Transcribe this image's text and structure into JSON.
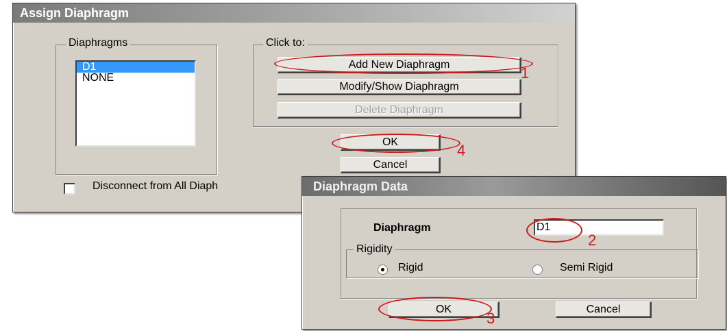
{
  "assign": {
    "title": "Assign Diaphragm",
    "diaphragms_group": "Diaphragms",
    "list": [
      "D1",
      "NONE"
    ],
    "click_group": "Click to:",
    "add_button": "Add New Diaphragm",
    "modify_button": "Modify/Show Diaphragm",
    "delete_button": "Delete Diaphragm",
    "ok_button": "OK",
    "cancel_button": "Cancel",
    "disconnect_label": "Disconnect from All Diaph"
  },
  "data_dialog": {
    "title": "Diaphragm Data",
    "diaphragm_label": "Diaphragm",
    "diaphragm_value": "D1",
    "rigidity_group": "Rigidity",
    "rigid_label": "Rigid",
    "semi_rigid_label": "Semi Rigid",
    "selected_rigidity": "Rigid",
    "ok_button": "OK",
    "cancel_button": "Cancel"
  },
  "annotations": {
    "step1": "1",
    "step2": "2",
    "step3": "3",
    "step4": "4",
    "color": "#cc1a1a"
  }
}
